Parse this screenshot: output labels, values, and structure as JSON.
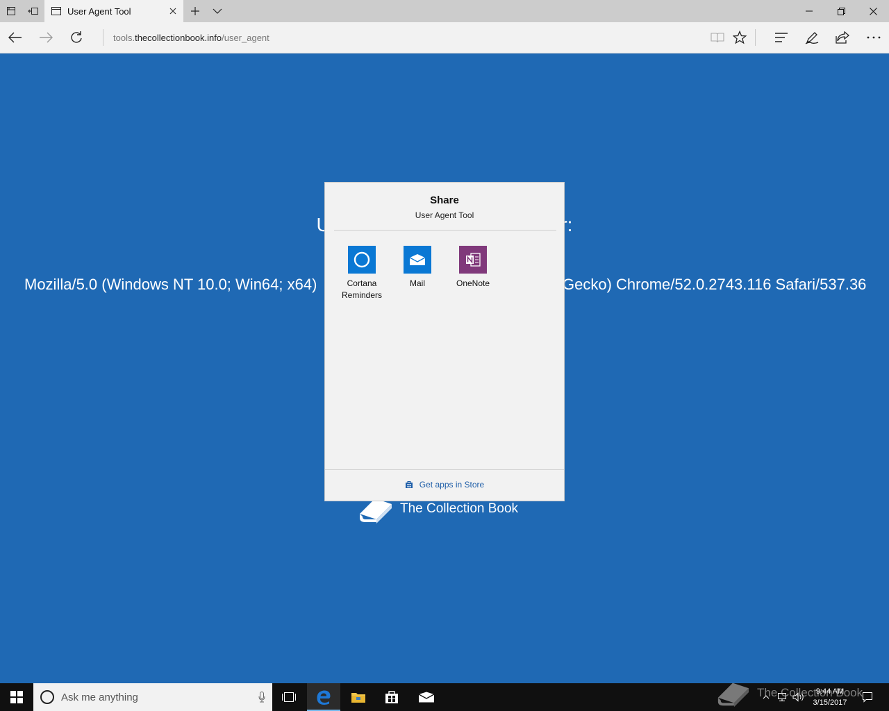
{
  "browser": {
    "tab_title": "User Agent Tool",
    "url_prefix": "tools.",
    "url_domain": "thecollectionbook.info",
    "url_path": "/user_agent"
  },
  "page": {
    "heading_left": "U",
    "heading_right": "er:",
    "ua_left": "Mozilla/5.0 (Windows NT 10.0; Win64; x64)",
    "ua_right": "Gecko) Chrome/52.0.2743.116 Safari/537.36",
    "brand_name": "The Collection Book"
  },
  "share": {
    "title": "Share",
    "subtitle": "User Agent Tool",
    "apps": [
      {
        "label": "Cortana Reminders",
        "color": "#0a78d4"
      },
      {
        "label": "Mail",
        "color": "#0a78d4"
      },
      {
        "label": "OneNote",
        "color": "#80397b"
      }
    ],
    "store_link": "Get apps in Store"
  },
  "taskbar": {
    "search_placeholder": "Ask me anything",
    "time": "9:44 AM",
    "date": "3/15/2017",
    "watermark": "The Collection Book"
  },
  "colors": {
    "page_background": "#1f69b4",
    "link": "#1e5ea8",
    "edge_blue": "#1e78d6"
  }
}
